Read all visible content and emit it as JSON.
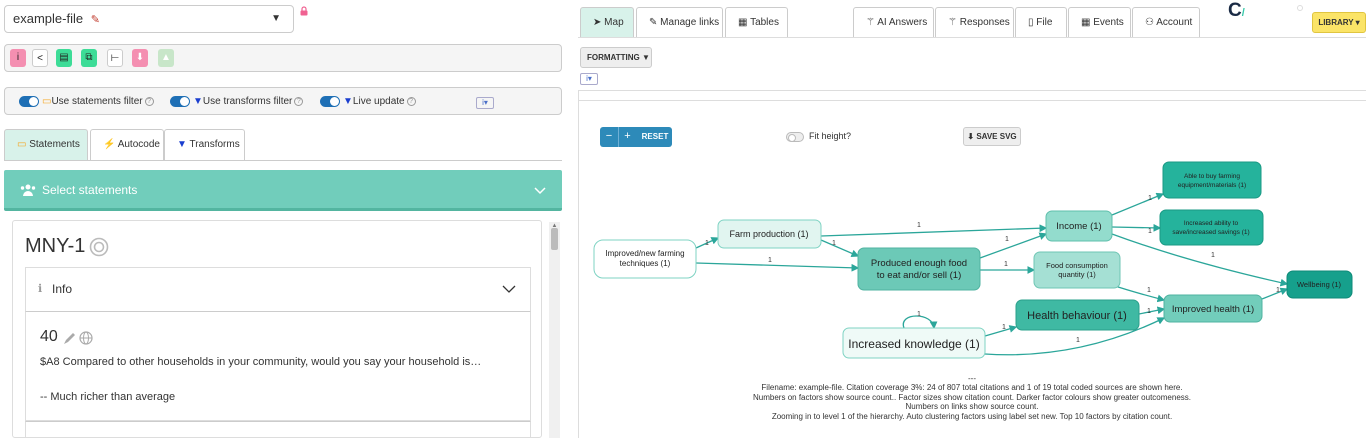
{
  "file": {
    "name": "example-file"
  },
  "filters": {
    "statements": "Use statements filter",
    "transforms": "Use transforms filter",
    "live": "Live update"
  },
  "left_tabs": [
    "Statements",
    "Autocode",
    "Transforms"
  ],
  "select_bar": {
    "label": "Select statements"
  },
  "statement_card": {
    "source_id": "MNY-1",
    "info_label": "Info",
    "statement_number": "40",
    "text": "$A8 Compared to other households in your community, would you say your household is…",
    "answer": "-- Much richer than average"
  },
  "right_tabs": {
    "map": "Map",
    "manage_links": "Manage links",
    "tables": "Tables",
    "ai_answers": "AI Answers",
    "responses": "Responses",
    "file": "File",
    "events": "Events",
    "account": "Account"
  },
  "logo_text": "C",
  "library": "LIBRARY",
  "formatting": "FORMATTING",
  "map_controls": {
    "minus": "−",
    "plus": "+",
    "reset": "RESET",
    "fit_height": "Fit height?",
    "save_svg": "SAVE SVG"
  },
  "graph": {
    "nodes": {
      "improved_farming": [
        "Improved/new farming",
        "techniques (1)"
      ],
      "farm_production": [
        "Farm production (1)"
      ],
      "produced_food": [
        "Produced enough food",
        "to eat and/or sell (1)"
      ],
      "income": [
        "Income (1)"
      ],
      "food_consumption": [
        "Food consumption",
        "quantity (1)"
      ],
      "able_to_buy": [
        "Able to buy farming",
        "equipment/materials (1)"
      ],
      "increased_savings": [
        "Increased ability to",
        "save/increased savings (1)"
      ],
      "wellbeing": [
        "Wellbeing (1)"
      ],
      "health_behaviour": [
        "Health behaviour (1)"
      ],
      "improved_health": [
        "Improved health (1)"
      ],
      "increased_knowledge": [
        "Increased knowledge (1)"
      ]
    },
    "link_label": "1"
  },
  "caption": [
    "---",
    "Filename: example-file. Citation coverage 3%: 24 of 807 total citations and 1 of 19 total coded sources are shown here.",
    "Numbers on factors show source count.. Factor sizes show citation count. Darker factor colours show greater outcomeness.",
    "Numbers on links show source count.",
    "Zooming in to level 1 of the hierarchy. Auto clustering factors using label set new. Top 10 factors by citation count."
  ],
  "colors": {
    "accent": "#71cdbb",
    "link": "#2ba69a",
    "blue": "#2d8ab9",
    "library": "#fbe467"
  }
}
